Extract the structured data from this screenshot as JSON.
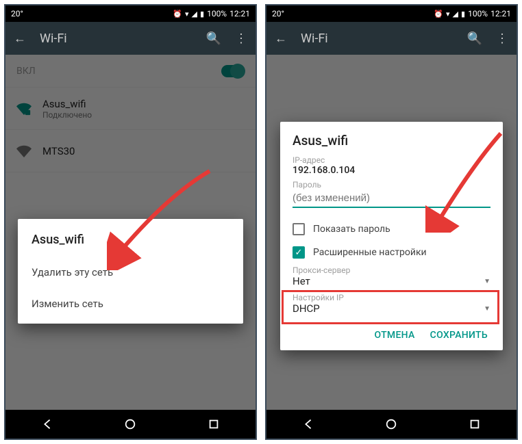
{
  "status": {
    "temperature": "20°",
    "battery_pct": "100%",
    "time": "12:21"
  },
  "appbar": {
    "title": "Wi-Fi"
  },
  "left": {
    "toggle_label": "ВКЛ",
    "networks": [
      {
        "name": "Asus_wifi",
        "sub": "Подключено"
      },
      {
        "name": "MTS30",
        "sub": ""
      }
    ],
    "context_menu": {
      "title": "Asus_wifi",
      "delete": "Удалить эту сеть",
      "modify": "Изменить сеть"
    }
  },
  "right": {
    "dialog": {
      "title": "Asus_wifi",
      "ip_label": "IP-адрес",
      "ip_value": "192.168.0.104",
      "password_label": "Пароль",
      "password_placeholder": "(без изменений)",
      "show_password": "Показать пароль",
      "advanced": "Расширенные настройки",
      "proxy_label": "Прокси-сервер",
      "proxy_value": "Нет",
      "ip_settings_label": "Настройки IP",
      "ip_settings_value": "DHCP",
      "cancel": "ОТМЕНА",
      "save": "СОХРАНИТЬ"
    }
  }
}
